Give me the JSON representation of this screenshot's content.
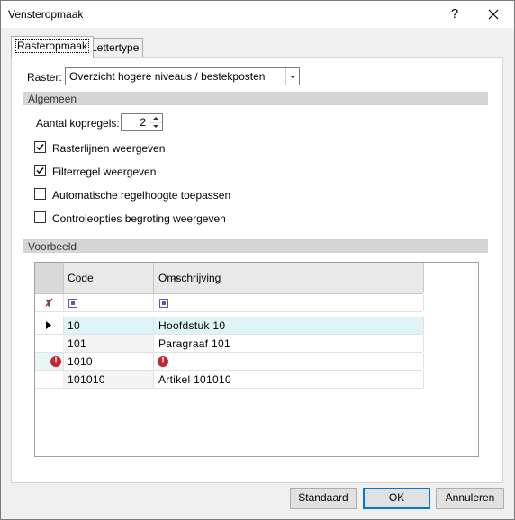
{
  "window": {
    "title": "Vensteropmaak",
    "help_label": "?"
  },
  "tabs": [
    {
      "label": "Rasteropmaak"
    },
    {
      "label": "Lettertype"
    }
  ],
  "raster": {
    "label": "Raster:",
    "value": "Overzicht hogere niveaus / bestekposten"
  },
  "algemeen": {
    "header": "Algemeen",
    "kopregels_label": "Aantal kopregels:",
    "kopregels_value": "2",
    "options": [
      {
        "label": "Rasterlijnen weergeven",
        "checked": true
      },
      {
        "label": "Filterregel weergeven",
        "checked": true
      },
      {
        "label": "Automatische regelhoogte toepassen",
        "checked": false
      },
      {
        "label": "Controleopties begroting weergeven",
        "checked": false
      }
    ]
  },
  "voorbeeld": {
    "header": "Voorbeeld",
    "columns": [
      "Code",
      "Omschrijving"
    ],
    "rows": [
      {
        "code": "10",
        "omschrijving": "Hoofdstuk 10",
        "current": true,
        "error": false
      },
      {
        "code": "101",
        "omschrijving": "Paragraaf 101",
        "current": false,
        "error": false
      },
      {
        "code": "1010",
        "omschrijving": "",
        "current": false,
        "error": true
      },
      {
        "code": "101010",
        "omschrijving": "Artikel 101010",
        "current": false,
        "error": false
      }
    ],
    "error_glyph": "!",
    "colors": {
      "selected_row": "#dff4f5",
      "code_column": "#f4f4f4",
      "error": "#c1272d"
    }
  },
  "buttons": {
    "standaard": "Standaard",
    "ok": "OK",
    "annuleren": "Annuleren"
  }
}
